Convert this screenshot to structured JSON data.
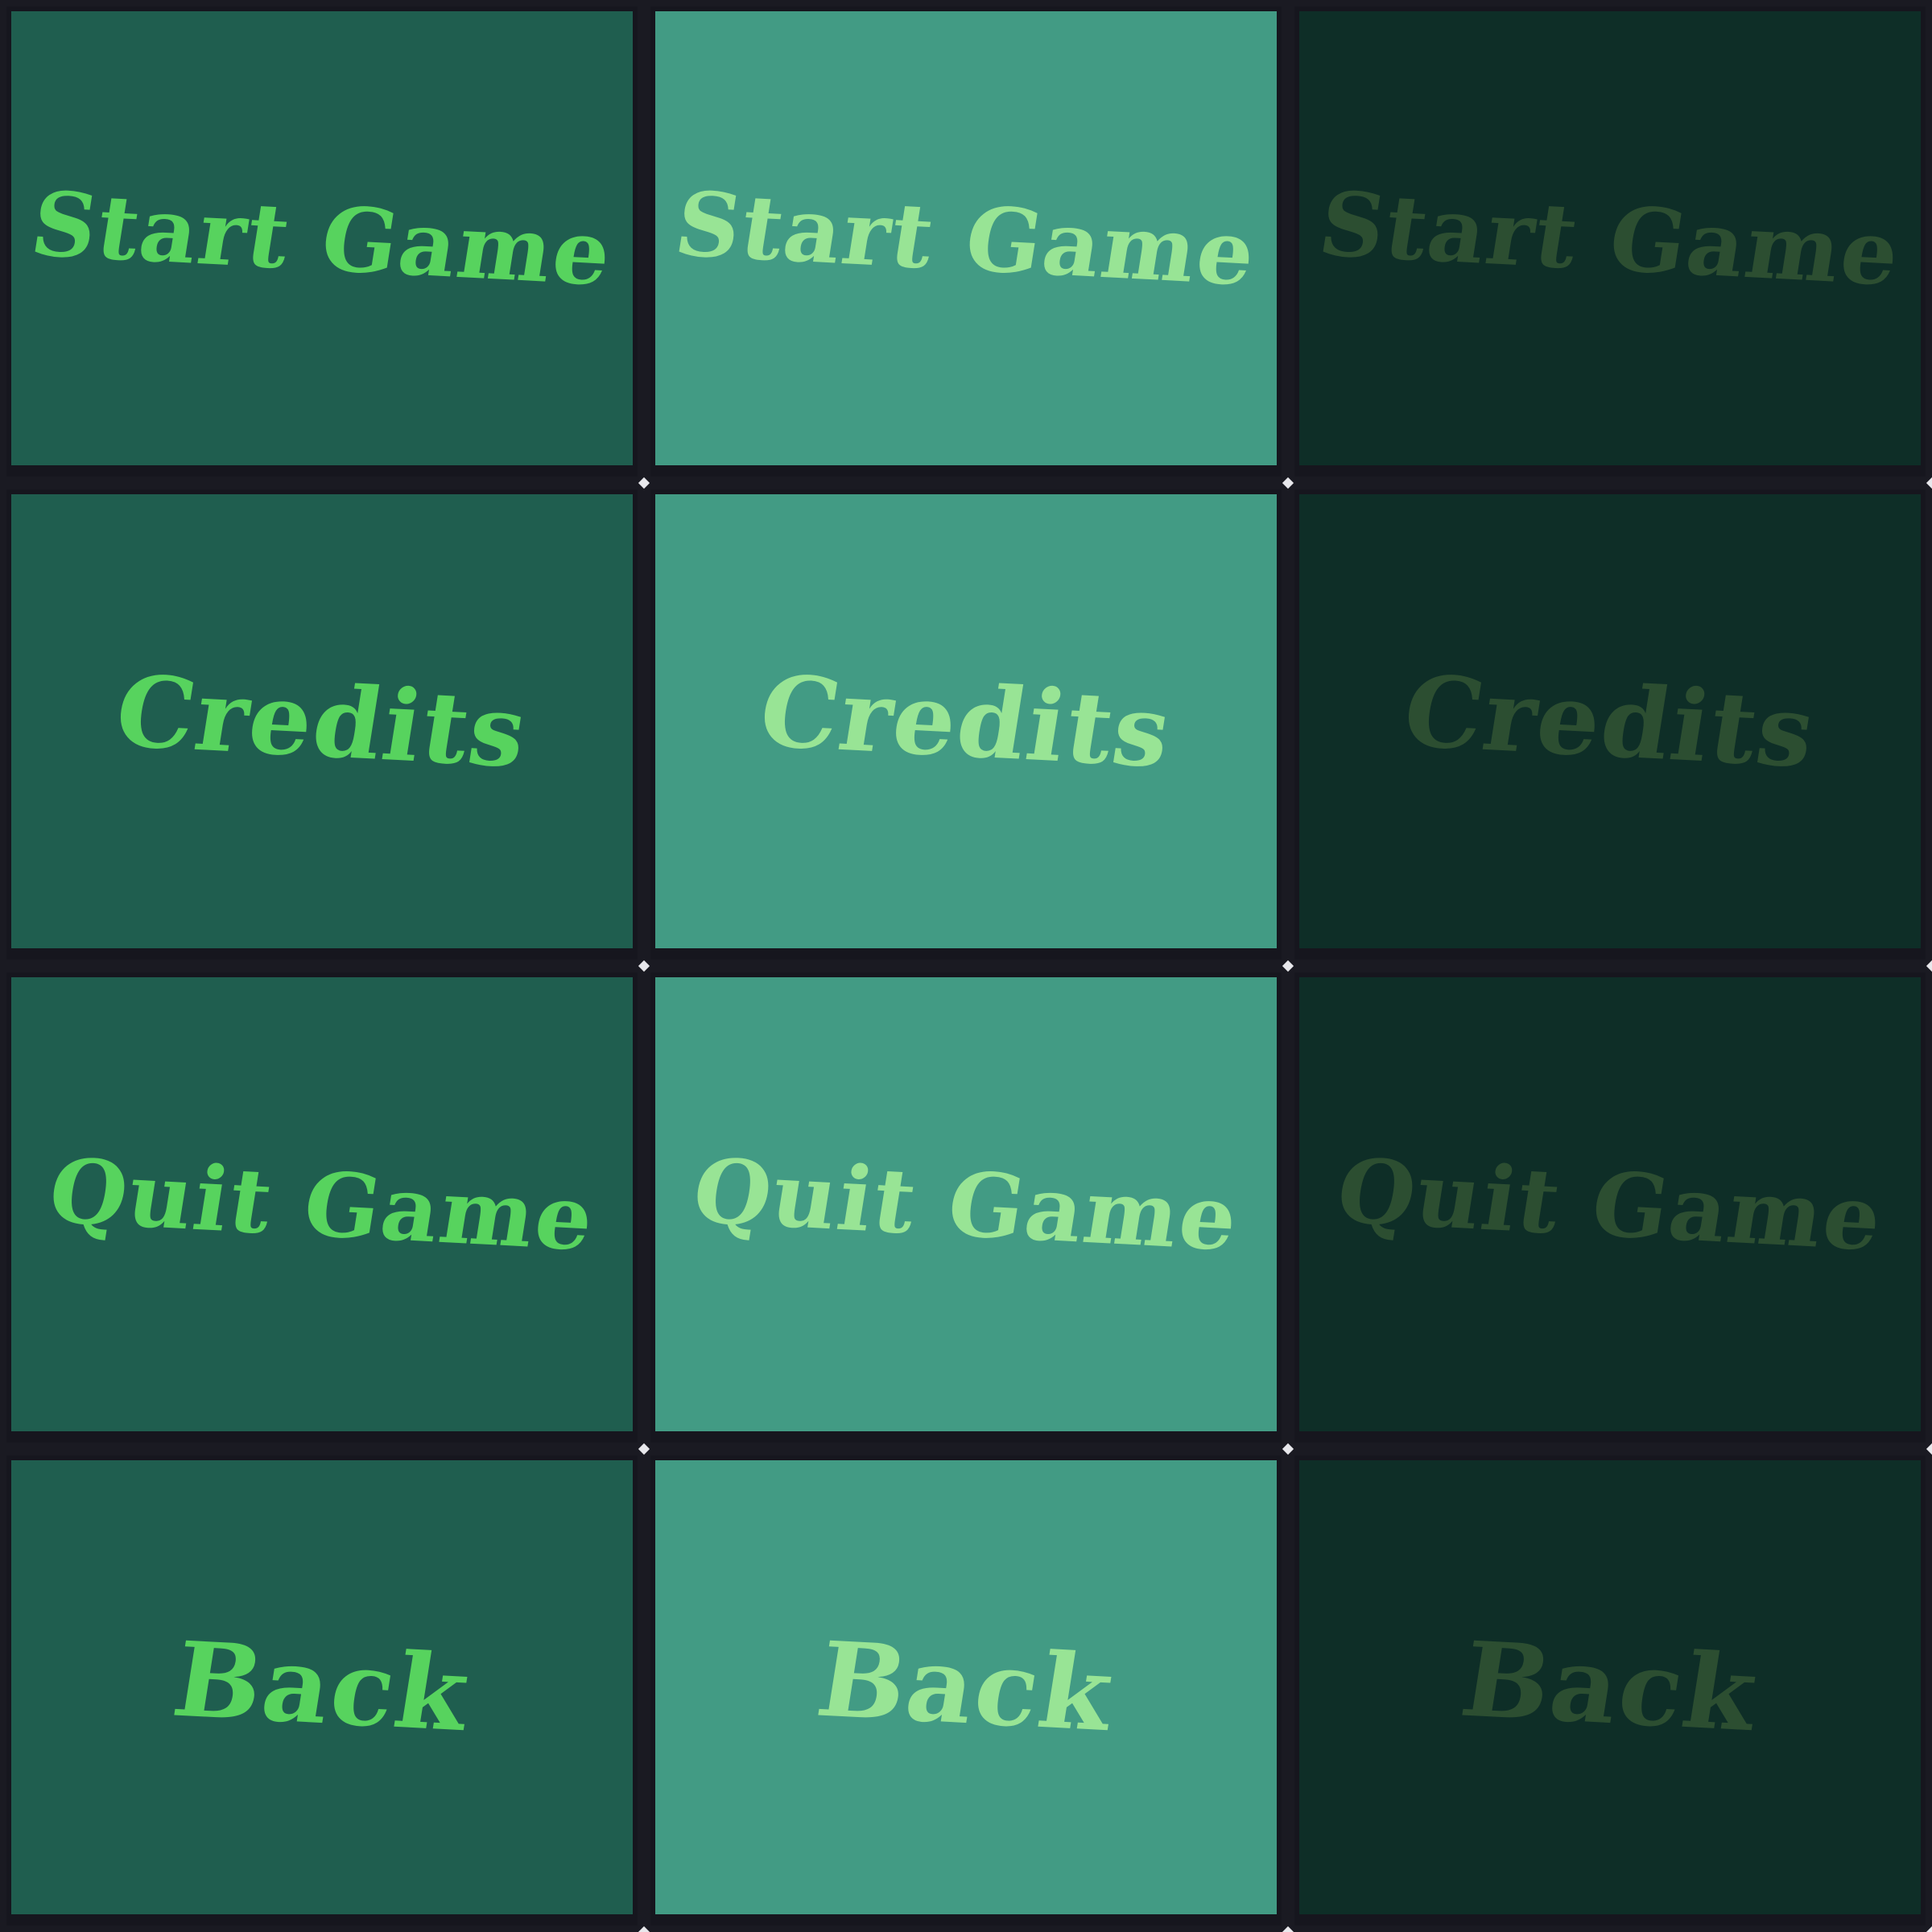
{
  "sheet": {
    "states": [
      "normal",
      "hover",
      "disabled"
    ],
    "buttons": [
      {
        "id": "start",
        "label": "Start Game"
      },
      {
        "id": "credits",
        "label": "Credits"
      },
      {
        "id": "quit",
        "label": "Quit Game"
      },
      {
        "id": "back",
        "label": "Back"
      }
    ]
  },
  "colors": {
    "frame": "#1a1a22",
    "normal_bg": "#1f5e4f",
    "normal_text": "#57d35e",
    "hover_bg": "#429b84",
    "hover_text": "#98e495",
    "disabled_bg": "#0e2e27",
    "disabled_text": "#2c4e31"
  }
}
